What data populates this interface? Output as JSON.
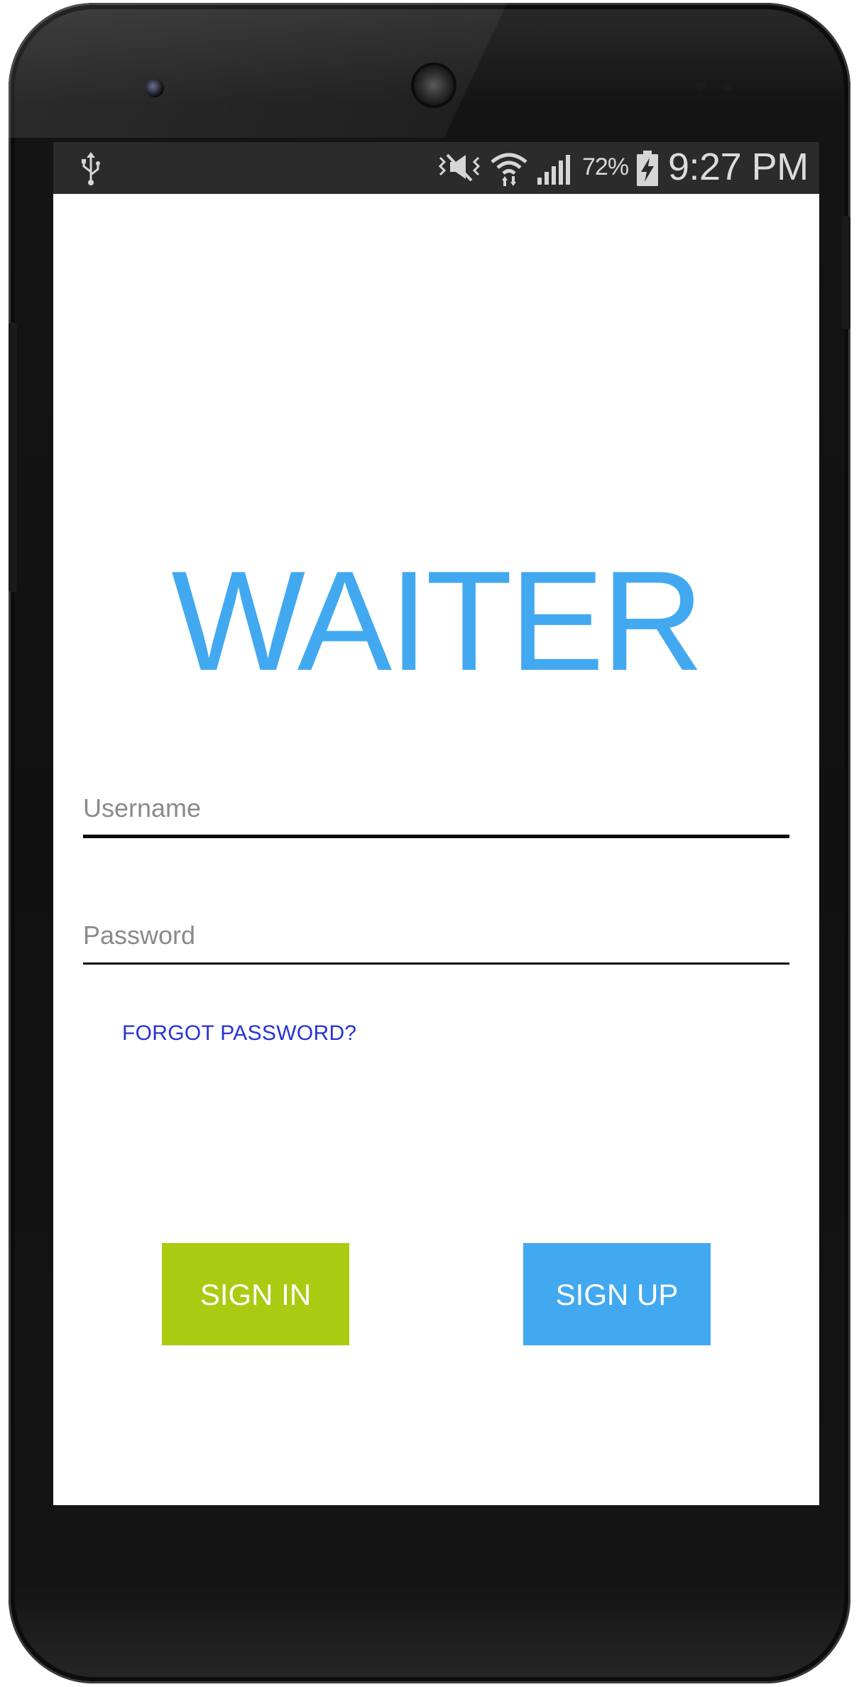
{
  "status_bar": {
    "battery_percent": "72%",
    "time": "9:27 PM",
    "icons": [
      "usb-icon",
      "mute-icon",
      "wifi-icon",
      "signal-icon",
      "battery-charging-icon"
    ]
  },
  "app": {
    "title": "WAITER",
    "username_placeholder": "Username",
    "password_placeholder": "Password",
    "forgot_password_label": "FORGOT PASSWORD?",
    "sign_in_label": "SIGN IN",
    "sign_up_label": "SIGN UP"
  },
  "colors": {
    "title_blue": "#42a9f0",
    "sign_in_green": "#abcb13",
    "sign_up_blue": "#42a9f0",
    "link_blue": "#2633d6"
  }
}
